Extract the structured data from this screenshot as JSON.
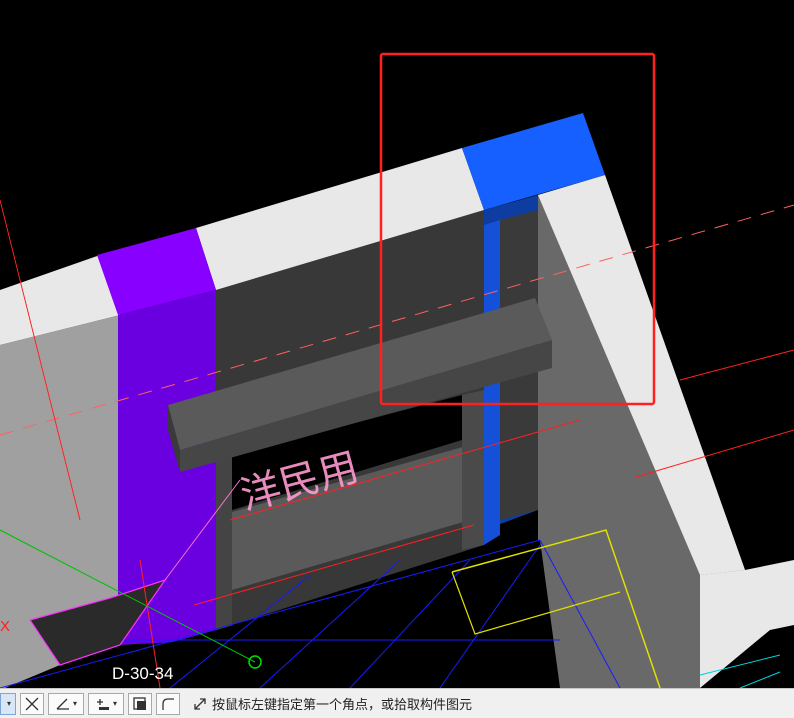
{
  "viewport": {
    "axis_grid_label": "D-30-34",
    "axis_x_label": "X",
    "room_text": "洋民用"
  },
  "statusbar": {
    "prompt": "按鼠标左键指定第一个角点，或拾取构件图元",
    "tools": [
      "select",
      "cancel",
      "angle",
      "offset",
      "snapshot",
      "arc-corner"
    ]
  },
  "colors": {
    "purple_column": "#8800ff",
    "blue_column": "#1560ff",
    "selection_box": "#ff2020",
    "wall_top": "#e8e8e8"
  }
}
